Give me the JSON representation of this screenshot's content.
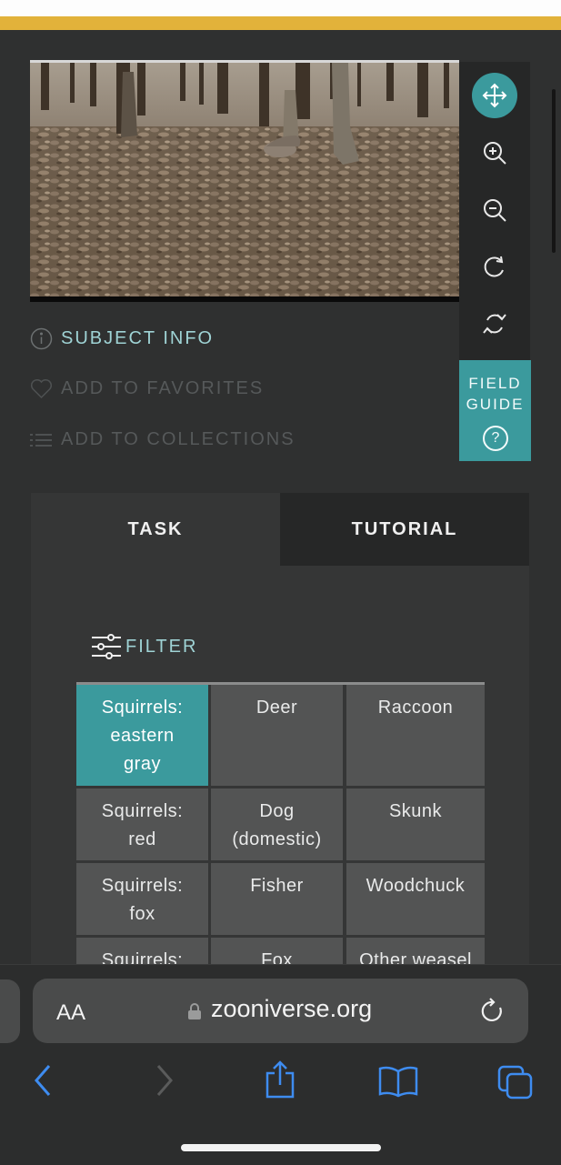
{
  "subject_links": {
    "info": "SUBJECT INFO",
    "favorites": "ADD TO FAVORITES",
    "collections": "ADD TO COLLECTIONS"
  },
  "toolbar": {
    "tools": [
      "move-icon",
      "zoom-in-icon",
      "zoom-out-icon",
      "rotate-icon",
      "reset-icon"
    ],
    "active_tool": "move-icon",
    "field_guide_label": "FIELD GUIDE",
    "field_guide_help": "?"
  },
  "tabs": {
    "task": "TASK",
    "tutorial": "TUTORIAL"
  },
  "filter_label": "FILTER",
  "choices": [
    [
      "Squirrels:",
      "eastern",
      "gray"
    ],
    [
      "Deer"
    ],
    [
      "Raccoon"
    ],
    [
      "Squirrels:",
      "red"
    ],
    [
      "Dog",
      "(domestic)"
    ],
    [
      "Skunk"
    ],
    [
      "Squirrels:",
      "fox"
    ],
    [
      "Fisher"
    ],
    [
      "Woodchuck"
    ],
    [
      "Squirrels:"
    ],
    [
      "Fox"
    ],
    [
      "Other weasel"
    ]
  ],
  "selected_choice": "Squirrels: eastern gray",
  "browser": {
    "aa_label": "AA",
    "url": "zooniverse.org"
  },
  "colors": {
    "accent": "#3b9a9d",
    "gold": "#e2b23a",
    "background": "#2f3030",
    "cell": "#535454"
  }
}
